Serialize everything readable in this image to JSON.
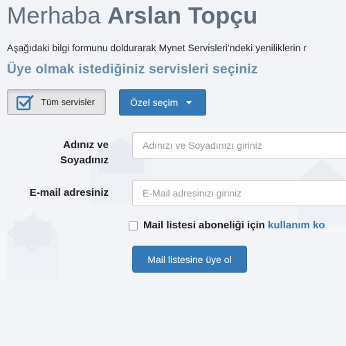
{
  "header": {
    "greeting_prefix": "Merhaba ",
    "user_name": "Arslan Topçu"
  },
  "intro_text": "Aşağıdaki bilgi formunu doldurarak Mynet Servisleri'ndeki yeniliklerin r",
  "section_title": "Üye olmak istediğiniz servisleri seçiniz",
  "selection": {
    "all_services_label": "Tüm servisler",
    "custom_selection_label": "Özel seçim"
  },
  "form": {
    "name_label": "Adınız ve Soyadınız",
    "name_placeholder": "Adınızı ve Soyadınızı giriniz",
    "email_label": "E-mail adresiniz",
    "email_placeholder": "E-Mail adresinizi giriniz",
    "subscription_text": "Mail listesi aboneliği için ",
    "terms_link": "kullanım ko",
    "submit_label": "Mail listesine üye ol"
  },
  "colors": {
    "primary": "#337ab7",
    "heading": "#5e6e7f",
    "section_title": "#6a8aab",
    "background": "#f2f4f7"
  }
}
